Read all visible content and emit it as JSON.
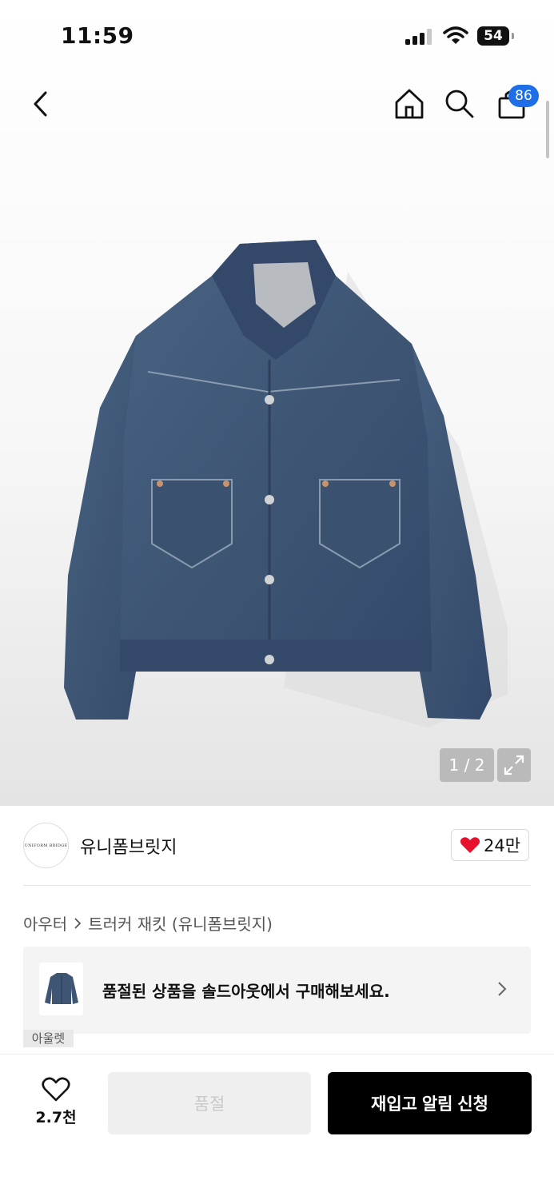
{
  "status_bar": {
    "time": "11:59",
    "battery": "54"
  },
  "nav": {
    "cart_count": "86"
  },
  "image": {
    "counter": "1 / 2"
  },
  "brand": {
    "name": "유니폼브릿지",
    "logo_text": "UNIFORM BRIDGE",
    "likes": "24만"
  },
  "breadcrumb": {
    "category": "아우터",
    "product": "트러커 재킷 (유니폼브릿지)"
  },
  "banner": {
    "text": "품절된 상품을 솔드아웃에서 구매해보세요.",
    "tag": "아울렛"
  },
  "bottom": {
    "wish_count": "2.7천",
    "soldout_label": "품절",
    "restock_label": "재입고 알림 신청"
  },
  "colors": {
    "accent_blue": "#1e6ee8",
    "like_red": "#e8112d",
    "denim": "#3e5674"
  }
}
